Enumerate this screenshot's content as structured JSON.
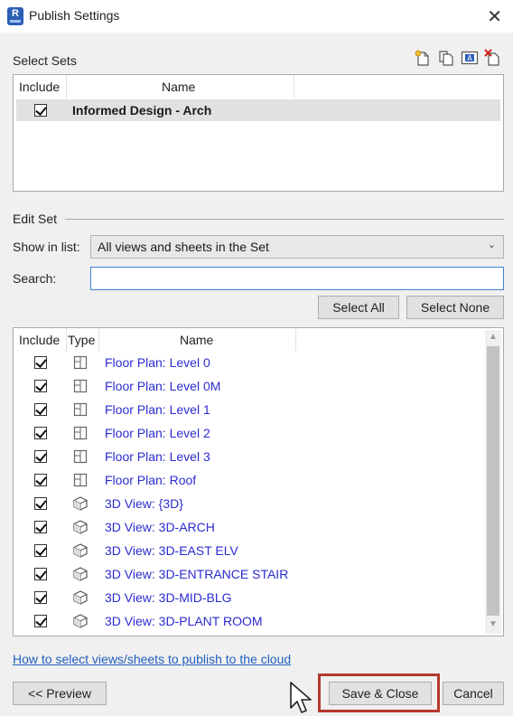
{
  "window": {
    "title": "Publish Settings",
    "app_icon_letter": "R",
    "close_glyph": "✕"
  },
  "select_sets": {
    "label": "Select Sets",
    "columns": {
      "include": "Include",
      "name": "Name"
    },
    "sets": [
      {
        "checked": true,
        "name": "Informed Design - Arch"
      }
    ],
    "toolbar_icons": [
      "new-set-icon",
      "duplicate-set-icon",
      "rename-set-icon",
      "delete-set-icon"
    ]
  },
  "edit_set": {
    "label": "Edit Set",
    "show_in_list_label": "Show in list:",
    "show_in_list_value": "All views and sheets in the Set",
    "search_label": "Search:",
    "search_value": "",
    "select_all": "Select All",
    "select_none": "Select None",
    "columns": {
      "include": "Include",
      "type": "Type",
      "name": "Name"
    },
    "views": [
      {
        "checked": true,
        "type": "floor-plan-icon",
        "name": "Floor Plan: Level 0"
      },
      {
        "checked": true,
        "type": "floor-plan-icon",
        "name": "Floor Plan: Level 0M"
      },
      {
        "checked": true,
        "type": "floor-plan-icon",
        "name": "Floor Plan: Level 1"
      },
      {
        "checked": true,
        "type": "floor-plan-icon",
        "name": "Floor Plan: Level 2"
      },
      {
        "checked": true,
        "type": "floor-plan-icon",
        "name": "Floor Plan: Level 3"
      },
      {
        "checked": true,
        "type": "floor-plan-icon",
        "name": "Floor Plan: Roof"
      },
      {
        "checked": true,
        "type": "3d-view-icon",
        "name": "3D View: {3D}"
      },
      {
        "checked": true,
        "type": "3d-view-icon",
        "name": "3D View: 3D-ARCH"
      },
      {
        "checked": true,
        "type": "3d-view-icon",
        "name": "3D View: 3D-EAST ELV"
      },
      {
        "checked": true,
        "type": "3d-view-icon",
        "name": "3D View: 3D-ENTRANCE STAIR"
      },
      {
        "checked": true,
        "type": "3d-view-icon",
        "name": "3D View: 3D-MID-BLG"
      },
      {
        "checked": true,
        "type": "3d-view-icon",
        "name": "3D View: 3D-PLANT ROOM"
      }
    ]
  },
  "footer": {
    "help_link": "How to select views/sheets to publish to the cloud",
    "preview": "<< Preview",
    "save_close": "Save & Close",
    "cancel": "Cancel"
  },
  "colors": {
    "link": "#2060c0",
    "view_name": "#2b2bd0",
    "highlight": "#b5392e",
    "app_icon": "#2a5fb5"
  }
}
